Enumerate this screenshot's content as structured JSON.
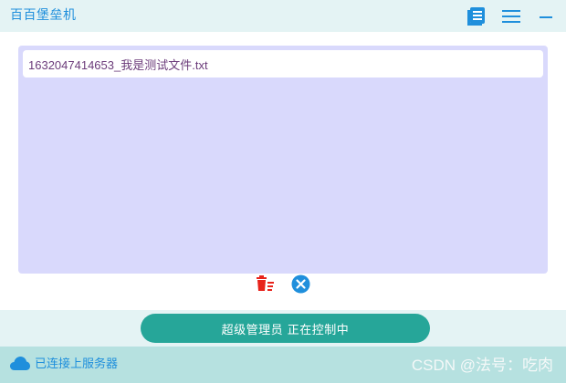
{
  "app": {
    "title": "百百堡垒机"
  },
  "titlebar": {
    "icons": [
      "document-list-icon",
      "menu-icon",
      "minimize-icon"
    ]
  },
  "file_list": {
    "items": [
      {
        "name": "1632047414653_我是测试文件.txt"
      }
    ]
  },
  "actions": {
    "icons": [
      "clear-list-icon",
      "close-circle-icon"
    ]
  },
  "control": {
    "status_label": "超级管理员 正在控制中"
  },
  "statusbar": {
    "connection_text": "已连接上服务器",
    "connection_icon": "cloud-icon",
    "watermark": "CSDN @法号：吃肉"
  },
  "colors": {
    "accent": "#1f8fdc",
    "band": "#e4f3f4",
    "list_bg": "#d9d9fc",
    "control_button": "#26a699",
    "statusbar": "#b6e1e0",
    "danger": "#e8231b"
  }
}
